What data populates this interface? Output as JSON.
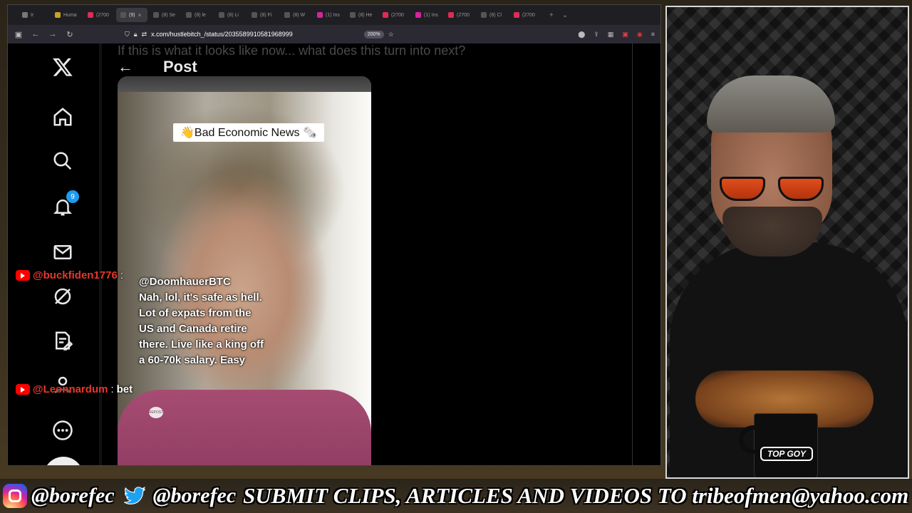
{
  "browser": {
    "tabs": [
      {
        "label": "Ir",
        "color": "#777"
      },
      {
        "label": "Huma",
        "color": "#c9a227"
      },
      {
        "label": "(2700",
        "color": "#e02b57"
      },
      {
        "label": "(9)",
        "color": "#555",
        "active": true
      },
      {
        "label": "(8) Se",
        "color": "#555"
      },
      {
        "label": "(8) le",
        "color": "#555"
      },
      {
        "label": "(8) Li",
        "color": "#555"
      },
      {
        "label": "(8) Fi",
        "color": "#555"
      },
      {
        "label": "(8) W",
        "color": "#555"
      },
      {
        "label": "(1) Ins",
        "color": "#d6249f"
      },
      {
        "label": "(8) He",
        "color": "#555"
      },
      {
        "label": "(2700",
        "color": "#e02b57"
      },
      {
        "label": "(1) Ins",
        "color": "#d6249f"
      },
      {
        "label": "(2700",
        "color": "#e02b57"
      },
      {
        "label": "(8) Cl",
        "color": "#555"
      },
      {
        "label": "(2700",
        "color": "#e02b57"
      }
    ],
    "url": "x.com/hustlebitch_/status/2035589910581968999",
    "zoom": "200%"
  },
  "x": {
    "faded_text": "If this is what it looks like now... what does this turn into next?",
    "header_title": "Post",
    "notification_count": "9",
    "video": {
      "label": "👋Bad Economic News 🗞️",
      "caption_handle": "@DoomhauerBTC",
      "caption_text": "Nah, lol, it's safe as hell. Lot of expats from the US and Canada retire there. Live like a king off a 60-70k salary. Easy",
      "repost": "REPOST"
    }
  },
  "chat": [
    {
      "user": "@buckfiden1776",
      "separator": ":",
      "message": ""
    },
    {
      "user": "@Leonnardum",
      "separator": ":",
      "message": "bet"
    }
  ],
  "webcam": {
    "mug_text": "TOP GOY"
  },
  "banner": {
    "instagram_handle": "@borefec",
    "twitter_handle": "@borefec",
    "submit_text": "SUBMIT CLIPS, ARTICLES AND VIDEOS TO tribeofmen@yahoo.com"
  },
  "colors": {
    "accent": "#1d9bf0",
    "youtube_red": "#ff0000",
    "chat_username": "#e8382c"
  }
}
